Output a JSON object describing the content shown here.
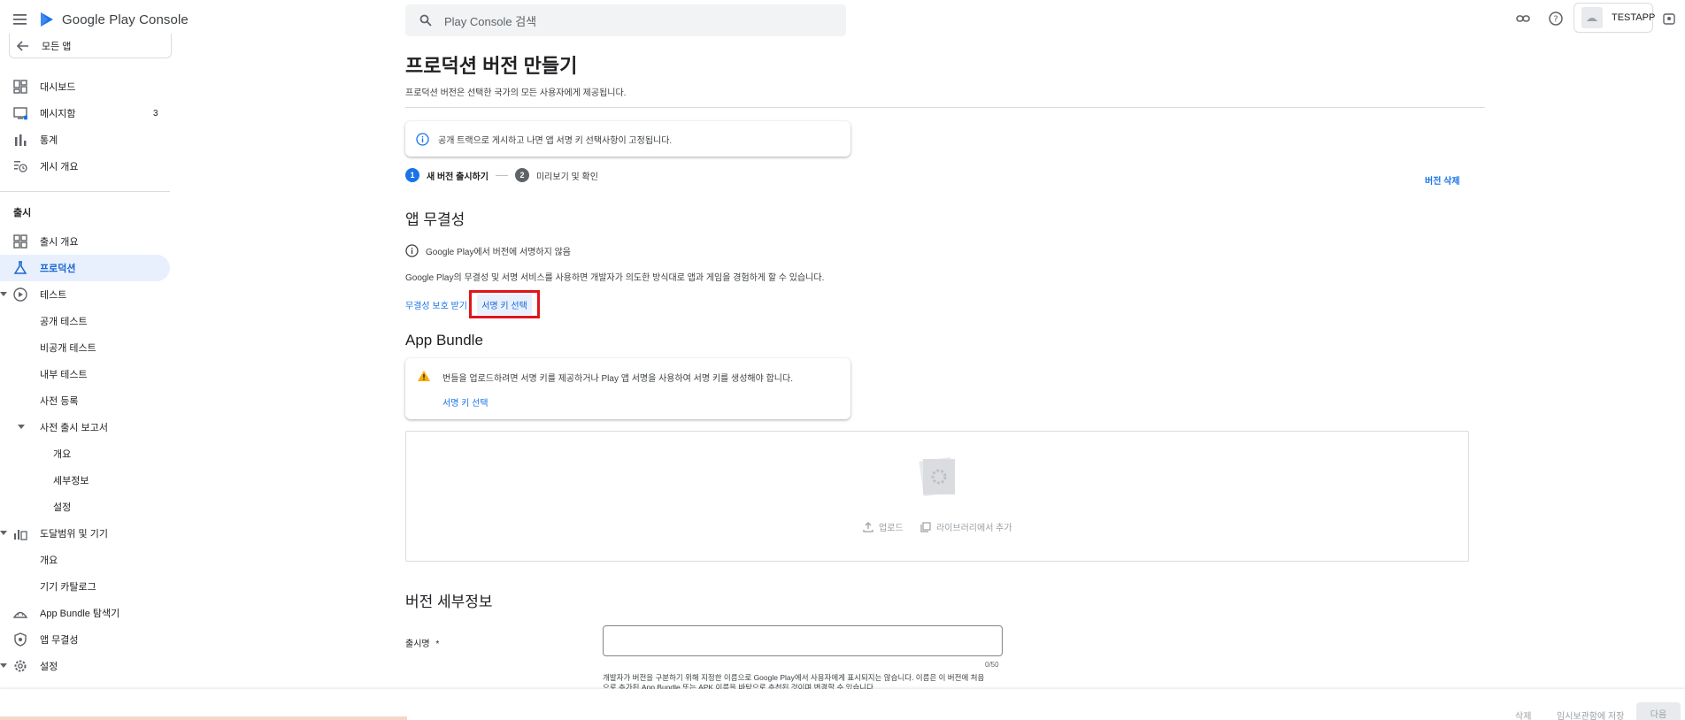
{
  "header": {
    "brand": "Google Play Console",
    "search_placeholder": "Play Console 검색",
    "app_name": "TESTAPP"
  },
  "sidebar": {
    "back_label": "모든 앱",
    "items": [
      {
        "label": "대시보드",
        "icon": "dashboard-icon"
      },
      {
        "label": "메시지함",
        "icon": "inbox-icon",
        "badge": "3"
      },
      {
        "label": "통계",
        "icon": "bar-chart-icon"
      },
      {
        "label": "게시 개요",
        "icon": "history-icon"
      }
    ],
    "release_section": "출시",
    "release_items": [
      {
        "label": "출시 개요"
      },
      {
        "label": "프로덕션"
      },
      {
        "label": "테스트"
      },
      {
        "label": "공개 테스트"
      },
      {
        "label": "비공개 테스트"
      },
      {
        "label": "내부 테스트"
      },
      {
        "label": "사전 등록"
      },
      {
        "label": "사전 출시 보고서"
      },
      {
        "label": "개요"
      },
      {
        "label": "세부정보"
      },
      {
        "label": "설정"
      },
      {
        "label": "도달범위 및 기기"
      },
      {
        "label": "개요"
      },
      {
        "label": "기기 카탈로그"
      },
      {
        "label": "App Bundle 탐색기"
      },
      {
        "label": "앱 무결성"
      },
      {
        "label": "설정"
      }
    ]
  },
  "main": {
    "title": "프로덕션 버전 만들기",
    "subtitle": "프로덕션 버전은 선택한 국가의 모든 사용자에게 제공됩니다.",
    "info_notice": "공개 트랙으로 게시하고 나면 앱 서명 키 선택사항이 고정됩니다.",
    "steps": [
      {
        "num": "1",
        "label": "새 버전 출시하기"
      },
      {
        "num": "2",
        "label": "미리보기 및 확인"
      }
    ],
    "delete_release": "버전 삭제",
    "integrity": {
      "title": "앱 무결성",
      "status": "Google Play에서 버전에 서명하지 않음",
      "description": "Google Play의 무결성 및 서명 서비스를 사용하면 개발자가 의도한 방식대로 앱과 게임을 경험하게 할 수 있습니다.",
      "protect_link": "무결성 보호 받기",
      "select_key_button": "서명 키 선택"
    },
    "app_bundle": {
      "title": "App Bundle",
      "warning": "번들을 업로드하려면 서명 키를 제공하거나 Play 앱 서명을 사용하여 서명 키를 생성해야 합니다.",
      "warning_link": "서명 키 선택",
      "upload_label": "업로드",
      "library_label": "라이브러리에서 추가"
    },
    "details": {
      "title": "버전 세부정보",
      "release_name_label": "출시명",
      "required_mark": "*",
      "counter": "0/50",
      "helper_line1": "개발자가 버전을 구분하기 위해 지정한 이름으로 Google Play에서 사용자에게 표시되지는 않습니다. 이름은 이 버전에 처음",
      "helper_line2": "으로 추가된 App Bundle 또는 APK 이름을 바탕으로 추천된 것이며 변경할 수 있습니다."
    }
  },
  "footer": {
    "delete": "삭제",
    "save_draft": "임시보관함에 저장",
    "next": "다음"
  },
  "colors": {
    "accent": "#1a73e8",
    "active_bg": "#e8f0fe",
    "highlight": "#e0141b",
    "warning": "#f9ab00"
  }
}
